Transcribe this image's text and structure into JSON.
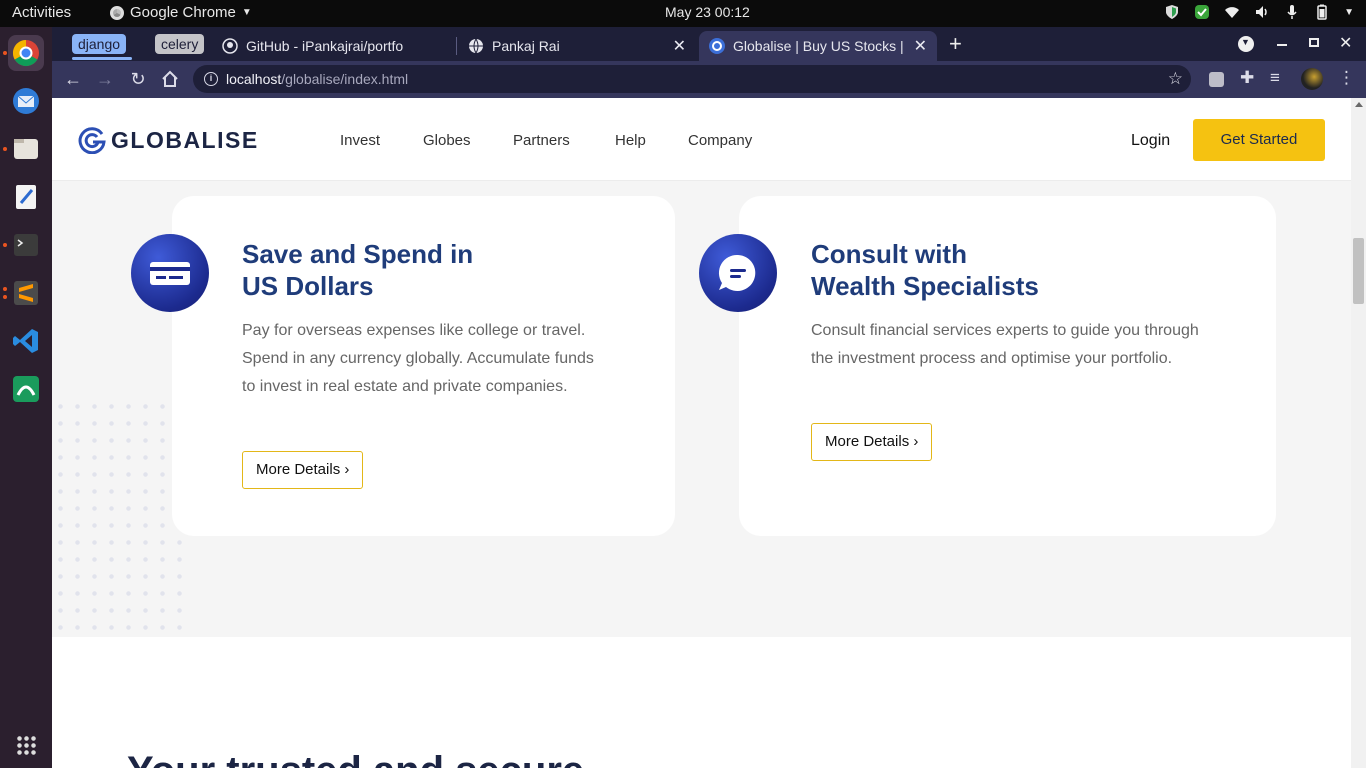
{
  "system": {
    "activities": "Activities",
    "app_name": "Google Chrome",
    "clock": "May 23  00:12"
  },
  "browser": {
    "tab_groups": [
      "django",
      "celery"
    ],
    "tabs": [
      {
        "title": "GitHub - iPankajrai/portfo"
      },
      {
        "title": "Pankaj Rai"
      },
      {
        "title": "Globalise | Buy US Stocks |"
      }
    ],
    "new_tab": "+",
    "url_host": "localhost",
    "url_path": "/globalise/index.html"
  },
  "site": {
    "brand": "GLOBALISE",
    "nav": [
      "Invest",
      "Globes",
      "Partners",
      "Help",
      "Company"
    ],
    "login": "Login",
    "cta": "Get Started"
  },
  "cards": [
    {
      "title_line1": "Save and Spend in",
      "title_line2": "US Dollars",
      "text": "Pay for overseas expenses like college or travel. Spend in any currency globally. Accumulate funds to invest in real estate and private companies.",
      "button": "More Details ›",
      "icon": "credit-card-icon"
    },
    {
      "title_line1": "Consult with",
      "title_line2": "Wealth Specialists",
      "text": "Consult financial services experts to guide you through the investment process and optimise your portfolio.",
      "button": "More Details ›",
      "icon": "chat-bubble-icon"
    }
  ],
  "section_title_partial": "Your trusted and secure",
  "colors": {
    "brand_navy": "#1f3c7a",
    "cta_yellow": "#f5c211",
    "tab_bg": "#1e1f38"
  }
}
